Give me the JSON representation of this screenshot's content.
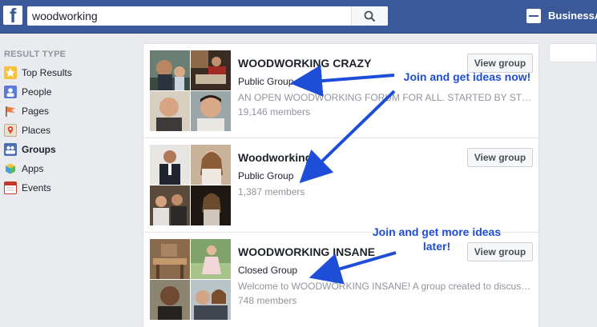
{
  "header": {
    "logo": "f",
    "search_value": "woodworking",
    "business_label": "BusinessA"
  },
  "sidebar": {
    "title": "RESULT TYPE",
    "items": [
      {
        "label": "Top Results",
        "icon": "star-icon",
        "color": "#f5c33b",
        "active": false
      },
      {
        "label": "People",
        "icon": "people-icon",
        "color": "#5b7bd5",
        "active": false
      },
      {
        "label": "Pages",
        "icon": "flag-icon",
        "color": "#f07b3f",
        "active": false
      },
      {
        "label": "Places",
        "icon": "map-pin-icon",
        "color": "#8bc34a",
        "active": false
      },
      {
        "label": "Groups",
        "icon": "groups-icon",
        "color": "#4a6fb5",
        "active": true
      },
      {
        "label": "Apps",
        "icon": "cube-icon",
        "color": "#3da1d9",
        "active": false
      },
      {
        "label": "Events",
        "icon": "calendar-icon",
        "color": "#c0392b",
        "active": false
      }
    ]
  },
  "results": [
    {
      "title": "WOODWORKING CRAZY",
      "type": "Public Group",
      "description": "AN OPEN WOODWORKING FORUM FOR ALL. STARTED BY STUART",
      "members": "19,146 members",
      "button": "View group"
    },
    {
      "title": "Woodworking",
      "type": "Public Group",
      "description": "",
      "members": "1,387 members",
      "button": "View group"
    },
    {
      "title": "WOODWORKING INSANE",
      "type": "Closed Group",
      "description": "Welcome to WOODWORKING INSANE! A group created to discuss woodworking",
      "members": "748 members",
      "button": "View group"
    }
  ],
  "annotations": {
    "first": "Join and get ideas now!",
    "second": "Join and get more ideas later!"
  },
  "colors": {
    "brand": "#3b5998",
    "annotation": "#1e4dd8"
  }
}
